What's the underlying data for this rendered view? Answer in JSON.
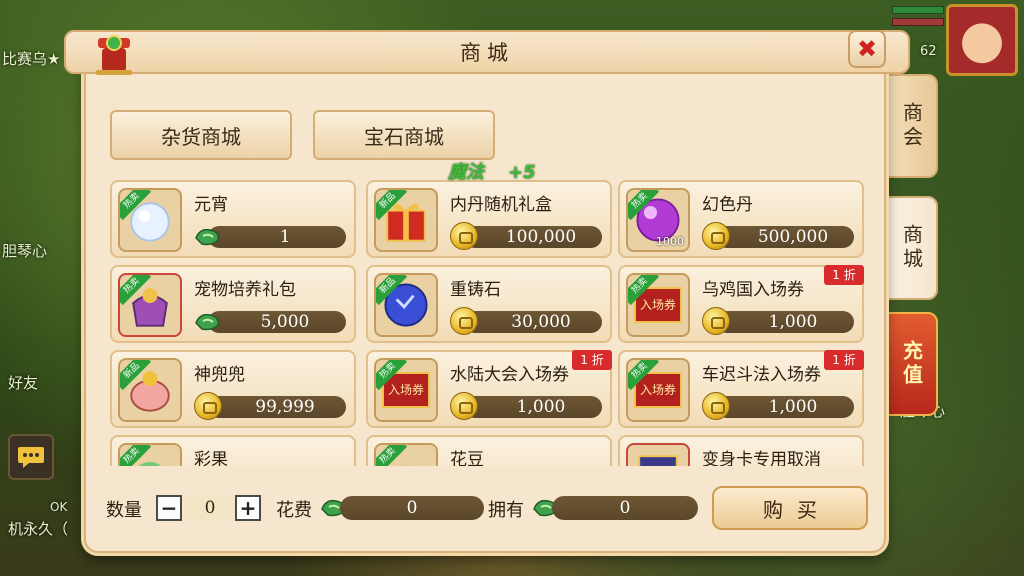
{
  "window": {
    "title": "商城"
  },
  "top_tabs": [
    {
      "label": "杂货商城"
    },
    {
      "label": "宝石商城"
    }
  ],
  "side_tabs": [
    {
      "label": "商会"
    },
    {
      "label": "商城"
    },
    {
      "label": "充值"
    }
  ],
  "buff": {
    "label": "魔法",
    "value": "+5"
  },
  "items": [
    {
      "name": "元宵",
      "badge": "热卖",
      "currency": "green-coin-icon",
      "price": "1",
      "discount": ""
    },
    {
      "name": "内丹随机礼盒",
      "badge": "新品",
      "currency": "gold-coin-icon",
      "price": "100,000",
      "discount": ""
    },
    {
      "name": "幻色丹",
      "badge": "热卖",
      "currency": "gold-coin-icon",
      "price": "500,000",
      "discount": "",
      "icon_qty": "1000"
    },
    {
      "name": "宠物培养礼包",
      "badge": "热卖",
      "currency": "green-coin-icon",
      "price": "5,000",
      "discount": ""
    },
    {
      "name": "重铸石",
      "badge": "新品",
      "currency": "gold-coin-icon",
      "price": "30,000",
      "discount": ""
    },
    {
      "name": "乌鸡国入场券",
      "badge": "热卖",
      "currency": "gold-coin-icon",
      "price": "1,000",
      "discount": "1 折",
      "ticket": "入场券"
    },
    {
      "name": "神兜兜",
      "badge": "新品",
      "currency": "gold-coin-icon",
      "price": "99,999",
      "discount": ""
    },
    {
      "name": "水陆大会入场券",
      "badge": "热卖",
      "currency": "gold-coin-icon",
      "price": "1,000",
      "discount": "1 折",
      "ticket": "入场券"
    },
    {
      "name": "车迟斗法入场券",
      "badge": "热卖",
      "currency": "gold-coin-icon",
      "price": "1,000",
      "discount": "1 折",
      "ticket": "入场券"
    },
    {
      "name": "彩果",
      "badge": "热卖",
      "currency": "",
      "price": "",
      "discount": ""
    },
    {
      "name": "花豆",
      "badge": "热卖",
      "currency": "",
      "price": "",
      "discount": ""
    },
    {
      "name": "变身卡专用取消",
      "badge": "",
      "currency": "",
      "price": "",
      "discount": ""
    }
  ],
  "footer": {
    "qty_label": "数量",
    "qty_value": "0",
    "minus": "−",
    "plus": "+",
    "cost_label": "花费",
    "cost_value": "0",
    "own_label": "拥有",
    "own_value": "0",
    "buy_label": "购买"
  },
  "background": {
    "name_1": "比赛乌★",
    "name_2": "胆琴心",
    "name_3": "胆琴心",
    "chat_tag": "好友",
    "chat_ok": "OK",
    "chat_name": "机永久（",
    "level": "62"
  },
  "colors": {
    "accent": "#d12222",
    "panel": "#f6e6cd",
    "price_bar": "#5a462a",
    "buff": "#43b83a"
  }
}
